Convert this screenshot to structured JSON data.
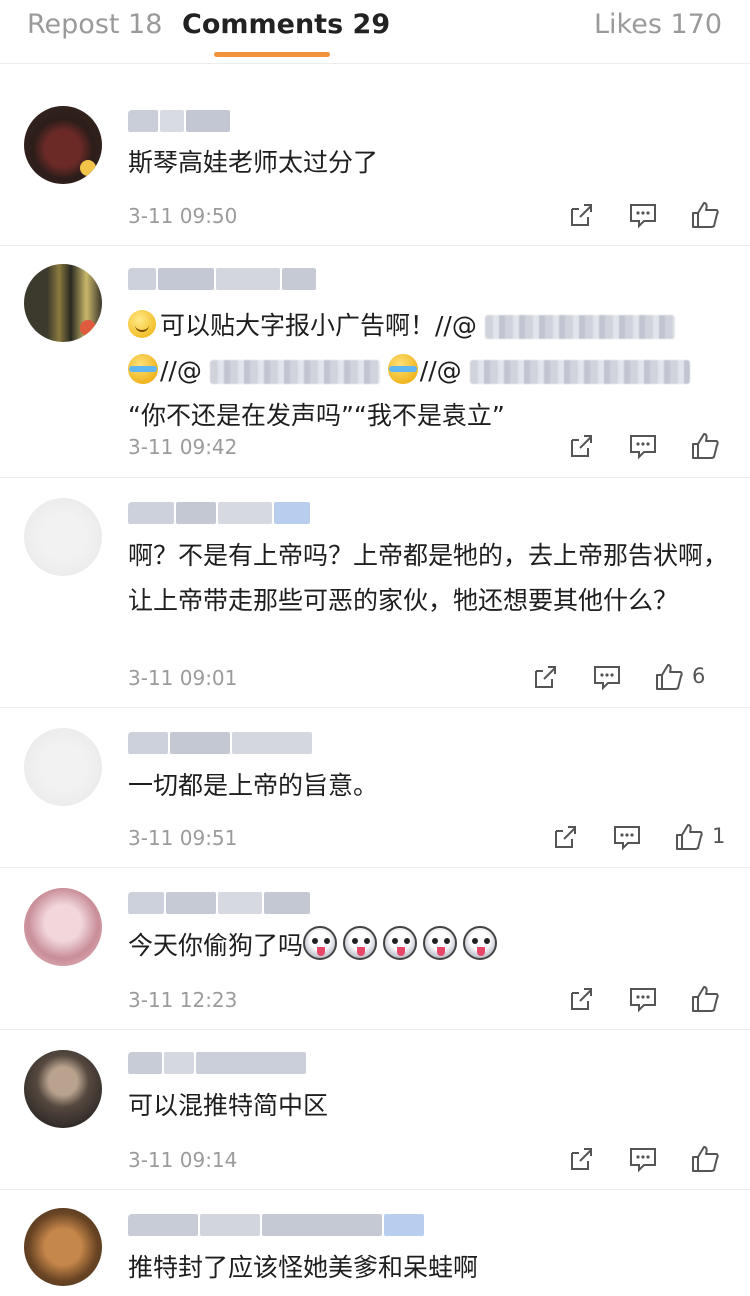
{
  "tabs": {
    "repost": "Repost 18",
    "comments": "Comments 29",
    "likes": "Likes 170"
  },
  "colors": {
    "accent": "#f0923a",
    "muted": "#9b9b9b",
    "divider": "#ededed"
  },
  "icons": [
    "repost-icon",
    "comment-icon",
    "like-icon"
  ],
  "comments": [
    {
      "text": "斯琴高娃老师太过分了",
      "time": "3-11 09:50",
      "likes": ""
    },
    {
      "line1_text": "可以贴大字报小广告啊！//@",
      "line2_sep1": "//@",
      "line2_sep2": "//@",
      "line3_text": "“你不还是在发声吗”“我不是袁立”",
      "time": "3-11 09:42",
      "likes": ""
    },
    {
      "text": "啊？不是有上帝吗？上帝都是牠的，去上帝那告状啊，让上帝带走那些可恶的家伙，牠还想要其他什么？",
      "time": "3-11 09:01",
      "likes": "6"
    },
    {
      "text": "一切都是上帝的旨意。",
      "time": "3-11 09:51",
      "likes": "1"
    },
    {
      "text": "今天你偷狗了吗",
      "time": "3-11 12:23",
      "likes": ""
    },
    {
      "text": "可以混推特简中区",
      "time": "3-11 09:14",
      "likes": ""
    },
    {
      "text": "推特封了应该怪她美爹和呆蛙啊",
      "time": "",
      "likes": ""
    }
  ]
}
